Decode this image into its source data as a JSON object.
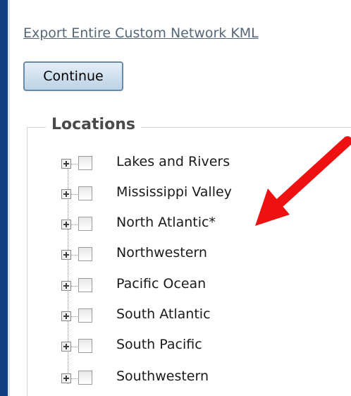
{
  "export_link": "Export Entire Custom Network KML",
  "continue_label": "Continue",
  "locations": {
    "legend": "Locations",
    "items": [
      {
        "label": "Lakes and Rivers"
      },
      {
        "label": "Mississippi Valley"
      },
      {
        "label": "North Atlantic*"
      },
      {
        "label": "Northwestern"
      },
      {
        "label": "Pacific Ocean"
      },
      {
        "label": "South Atlantic"
      },
      {
        "label": "South Pacific"
      },
      {
        "label": "Southwestern"
      }
    ]
  },
  "colors": {
    "accent_edge": "#0f3f80",
    "annotation_arrow": "#ee1111"
  },
  "icons": {
    "expander": "plus-box-icon",
    "annotation": "red-arrow-icon"
  }
}
